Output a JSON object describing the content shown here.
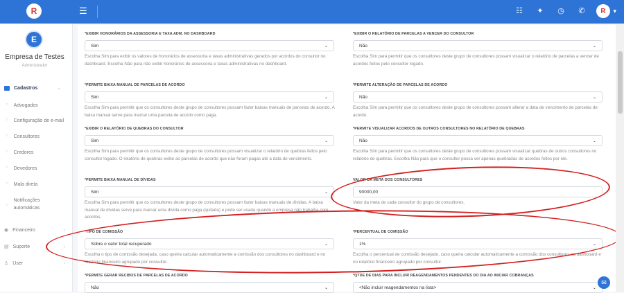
{
  "header": {
    "logo_text": "R",
    "icons": [
      "list-icon",
      "handshake-icon",
      "clock-icon",
      "whatsapp-icon"
    ],
    "avatar_text": "R"
  },
  "sidebar": {
    "company_initial": "E",
    "company_name": "Empresa de Testes",
    "company_role": "Administrador",
    "section": "Cadastros",
    "items": [
      {
        "label": "Advogados"
      },
      {
        "label": "Configuração de e-mail"
      },
      {
        "label": "Consultores"
      },
      {
        "label": "Credores"
      },
      {
        "label": "Devedores"
      },
      {
        "label": "Mala direta"
      },
      {
        "label": "Notificações automáticas"
      }
    ],
    "bottom": [
      {
        "label": "Financeiro"
      },
      {
        "label": "Suporte"
      },
      {
        "label": "User"
      }
    ]
  },
  "form": {
    "f1": {
      "label": "*EXIBIR HONORÁRIOS DA ASSESSORIA E TAXA ADM. NO DASHBOARD",
      "value": "Sim",
      "help": "Escolha Sim para exibir os valores de honorários de assessoria e taxas administrativas gerados por acordos do consultor no dashboard. Escolha Não para não exibir honorários de assessoria e taxas administrativas no dashboard."
    },
    "f2": {
      "label": "*EXIBIR O RELATÓRIO DE PARCELAS A VENCER DO CONSULTOR",
      "value": "Não",
      "help": "Escolha Sim para permitir que os consultores deste grupo de consultores possam visualizar o relatório de parcelas a vencer de acordos feitos pelo consultor logado."
    },
    "f3": {
      "label": "*PERMITE BAIXA MANUAL DE PARCELAS DE ACORDO",
      "value": "Sim",
      "help": "Escolha Sim para permitir que os consultores deste grupo de consultores possam fazer baixas manuais de parcelas de acordo. A baixa manual serve para marcar uma parcela de acordo como paga."
    },
    "f4": {
      "label": "*PERMITE ALTERAÇÃO DE PARCELAS DE ACORDO",
      "value": "Não",
      "help": "Escolha Sim para permitir que os consultores deste grupo de consultores possam alterar a data de vencimento de parcelas de acordo."
    },
    "f5": {
      "label": "*EXIBIR O RELATÓRIO DE QUEBRAS DO CONSULTOR",
      "value": "Sim",
      "help": "Escolha Sim para permitir que os consultores deste grupo de consultores possam visualizar o relatório de quebras feitos pelo consultor logado. O relatório de quebras exibe as parcelas de acordo que não foram pagas até a data do vencimento."
    },
    "f6": {
      "label": "*PERMITE VISUALIZAR ACORDOS DE OUTROS CONSULTORES NO RELATÓRIO DE QUEBRAS",
      "value": "Não",
      "help": "Escolha Sim para permitir que os consultores deste grupo de consultores possam visualizar quebras de outros consultores no relatório de quebras. Escolha Não para que o consultor possa ver apenas quebradas de acordos feitos por ele."
    },
    "f7": {
      "label": "*PERMITE BAIXA MANUAL DE DÍVIDAS",
      "value": "Sim",
      "help": "Escolha Sim para permitir que os consultores deste grupo de consultores possam fazer baixas manuais de dívidas. A baixa manual de dívidas serve para marcar uma dívida como paga (quitada) e pode ser usada quando a empresa não trabalha com acordos."
    },
    "f8": {
      "label": "VALOR DA META DOS CONSULTORES",
      "value": "90000,00",
      "help": "Valor da meta de cada consultor do grupo de consultores."
    },
    "f9": {
      "label": "*TIPO DE COMISSÃO",
      "value": "Sobre o valor total recuperado",
      "help": "Escolha o tipo de comissão desejada, caso queira calcular automaticamente a comissão dos consultores no dashboard e no relatório financeiro agrupado por consultor."
    },
    "f10": {
      "label": "*PERCENTUAL DE COMISSÃO",
      "value": "1%",
      "help": "Escolha o percentual de comissão desejado, caso queira calcular automaticamente a comissão dos consultores no dashboard e no relatório financeiro agrupado por consultor."
    },
    "f11": {
      "label": "*PERMITE GERAR RECIBOS DE PARCELAS DE ACORDO",
      "value": "Não"
    },
    "f12": {
      "label": "*QTDE DE DIAS PARA INCLUIR REAGENDAMENTOS PENDENTES DO DIA AO INICIAR COBRANÇAS",
      "value": "<Não incluir reagendamentos na lista>"
    }
  },
  "colors": {
    "primary": "#2d74d6",
    "annotation": "#d41f1f"
  }
}
